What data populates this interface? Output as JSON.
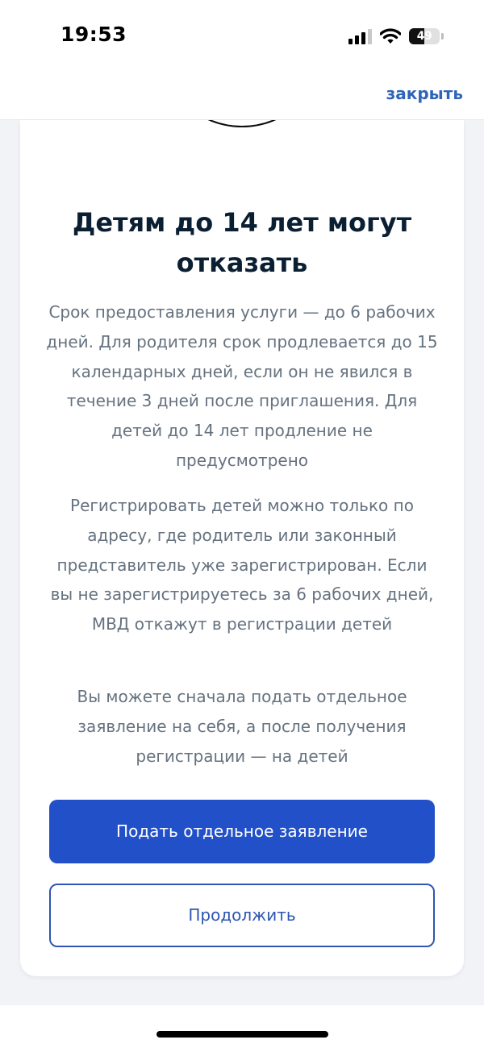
{
  "status_bar": {
    "time": "19:53",
    "battery_level": "49",
    "battery_fraction": 0.49,
    "icons": [
      "cellular-signal-icon",
      "wifi-icon",
      "battery-icon"
    ]
  },
  "header": {
    "close_label": "закрыть"
  },
  "card": {
    "title": "Детям до 14 лет могут отказать",
    "paragraphs": [
      "Срок предоставления услуги — до 6 рабочих дней. Для родителя срок продлевается до 15 календарных дней, если он не явился в течение 3 дней после приглашения. Для детей до 14 лет продление не предусмотрено",
      "Регистрировать детей можно только по адресу, где родитель или законный представитель уже зарегистрирован. Если вы не зарегистрируетесь за 6 рабочих дней, МВД откажут в регистрации детей",
      "Вы можете сначала подать отдельное заявление на себя, а после получения регистрации — на детей"
    ],
    "primary_button": "Подать отдельное заявление",
    "secondary_button": "Продолжить"
  },
  "colors": {
    "accent": "#2250c8",
    "link": "#2f64b8",
    "title": "#0b1f33",
    "body_text": "#66727f",
    "background": "#f1f3f7"
  }
}
